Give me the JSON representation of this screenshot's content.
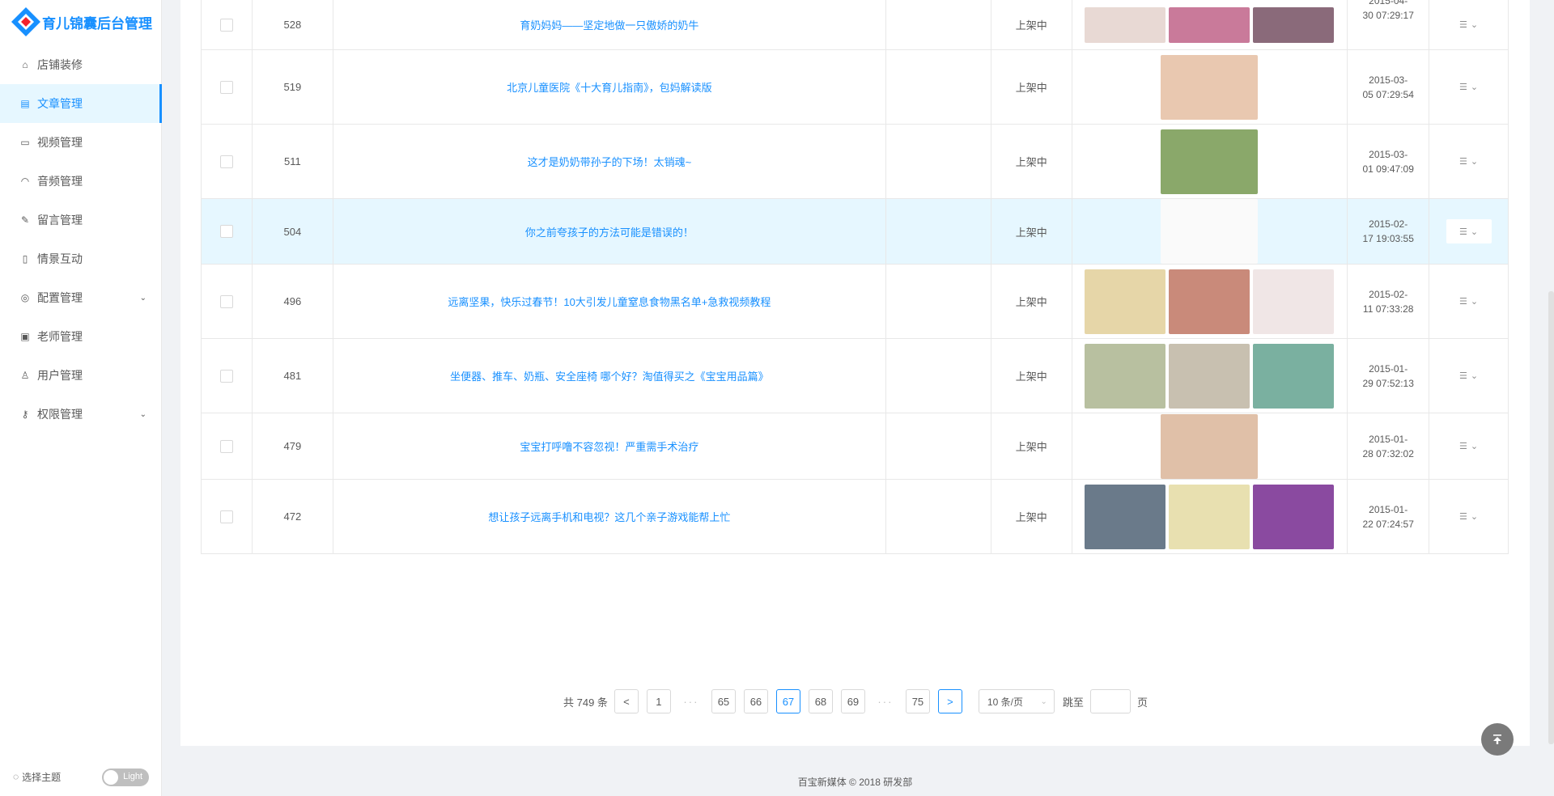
{
  "app": {
    "title": "育儿锦囊后台管理"
  },
  "sidebar": {
    "items": [
      {
        "label": "店铺装修",
        "icon": "store-icon"
      },
      {
        "label": "文章管理",
        "icon": "document-icon",
        "active": true
      },
      {
        "label": "视频管理",
        "icon": "video-icon"
      },
      {
        "label": "音频管理",
        "icon": "headphones-icon"
      },
      {
        "label": "留言管理",
        "icon": "edit-icon"
      },
      {
        "label": "情景互动",
        "icon": "book-icon"
      },
      {
        "label": "配置管理",
        "icon": "settings-icon",
        "expandable": true
      },
      {
        "label": "老师管理",
        "icon": "contacts-icon"
      },
      {
        "label": "用户管理",
        "icon": "user-icon"
      },
      {
        "label": "权限管理",
        "icon": "key-icon",
        "expandable": true
      }
    ],
    "theme_label": "选择主题",
    "theme_toggle": "Light"
  },
  "table": {
    "rows": [
      {
        "id": "528",
        "title": "育奶妈妈——坚定地做一只傲娇的奶牛",
        "status": "上架中",
        "date_line1": "2015-04-",
        "date_line2": "30 07:29:17",
        "images": 3,
        "colors": [
          "#e8d9d4",
          "#c97a9a",
          "#8a6a7a"
        ]
      },
      {
        "id": "519",
        "title": "北京儿童医院《十大育儿指南》，包妈解读版",
        "status": "上架中",
        "date_line1": "2015-03-",
        "date_line2": "05 07:29:54",
        "images": 1,
        "colors": [
          "#e9c8b0"
        ]
      },
      {
        "id": "511",
        "title": "这才是奶奶带孙子的下场！太销魂~",
        "status": "上架中",
        "date_line1": "2015-03-",
        "date_line2": "01 09:47:09",
        "images": 1,
        "colors": [
          "#8aa86a"
        ]
      },
      {
        "id": "504",
        "title": "你之前夸孩子的方法可能是错误的！",
        "status": "上架中",
        "date_line1": "2015-02-",
        "date_line2": "17 19:03:55",
        "images": 1,
        "colors": [
          "#f3ece6"
        ],
        "highlight": true
      },
      {
        "id": "496",
        "title": "远离坚果，快乐过春节！10大引发儿童窒息食物黑名单+急救视频教程",
        "status": "上架中",
        "date_line1": "2015-02-",
        "date_line2": "11 07:33:28",
        "images": 3,
        "colors": [
          "#e6d6a8",
          "#c98a7a",
          "#f0e6e6"
        ]
      },
      {
        "id": "481",
        "title": "坐便器、推车、奶瓶、安全座椅 哪个好？淘值得买之《宝宝用品篇》",
        "status": "上架中",
        "date_line1": "2015-01-",
        "date_line2": "29 07:52:13",
        "images": 3,
        "colors": [
          "#b8c0a0",
          "#c8c0b0",
          "#7ab0a0"
        ]
      },
      {
        "id": "479",
        "title": "宝宝打呼噜不容忽视！严重需手术治疗",
        "status": "上架中",
        "date_line1": "2015-01-",
        "date_line2": "28 07:32:02",
        "images": 1,
        "colors": [
          "#e0c0a8"
        ]
      },
      {
        "id": "472",
        "title": "想让孩子远离手机和电视？这几个亲子游戏能帮上忙",
        "status": "上架中",
        "date_line1": "2015-01-",
        "date_line2": "22 07:24:57",
        "images": 3,
        "colors": [
          "#6a7a8a",
          "#e8e0b0",
          "#8a4aa0"
        ]
      }
    ]
  },
  "pagination": {
    "total": "共 749 条",
    "pages": [
      "1",
      "65",
      "66",
      "67",
      "68",
      "69",
      "75"
    ],
    "current": "67",
    "ellipsis": "···",
    "page_size": "10 条/页",
    "jump_label": "跳至",
    "page_suffix": "页"
  },
  "footer": {
    "text": "百宝新媒体 © 2018 研发部"
  },
  "colors": {
    "primary": "#1890ff",
    "highlight_row": "#e6f7ff"
  }
}
